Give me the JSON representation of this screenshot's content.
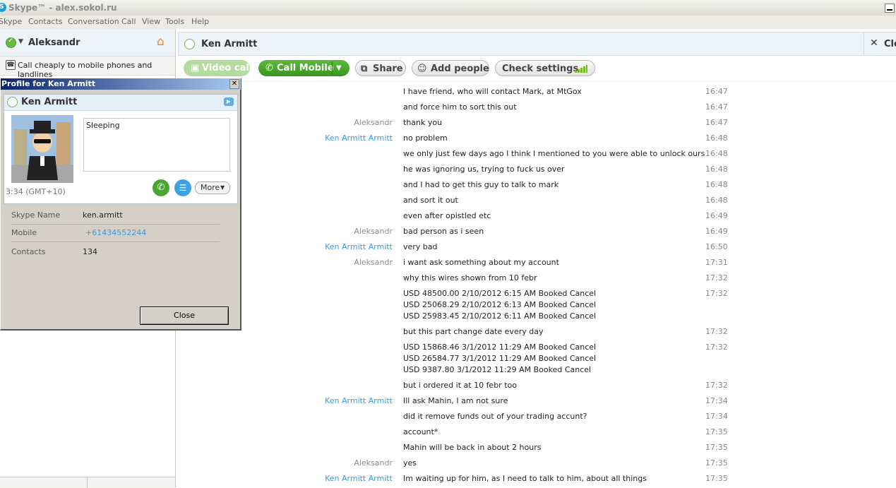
{
  "window": {
    "title": "Skype™ - alex.sokol.ru",
    "icon": "skype-icon"
  },
  "menu": [
    "Skype",
    "Contacts",
    "Conversation",
    "Call",
    "View",
    "Tools",
    "Help"
  ],
  "sidebar": {
    "user_name": "Aleksandr",
    "promo_text": "Call cheaply to mobile phones and landlines",
    "status_color": "#6ab943"
  },
  "conversation": {
    "contact_name": "Ken Armitt",
    "close_label": "Clo",
    "toolbar": {
      "video_call": "Video call",
      "call_mobile": "Call Mobile",
      "share": "Share",
      "add_people": "Add people",
      "check_settings": "Check settings"
    },
    "messages": [
      {
        "sender": "",
        "lines": [
          "I have friend, who will contact Mark, at MtGox"
        ],
        "time": "16:47",
        "ken": false
      },
      {
        "sender": "",
        "lines": [
          "and force him to sort this out"
        ],
        "time": "16:47",
        "ken": false
      },
      {
        "sender": "Aleksandr",
        "lines": [
          "thank you"
        ],
        "time": "16:47",
        "ken": false
      },
      {
        "sender": "Ken Armitt Armitt",
        "lines": [
          "no problem"
        ],
        "time": "16:48",
        "ken": true
      },
      {
        "sender": "",
        "lines": [
          "we only just few days ago I think I mentioned to you were able to unlock ours"
        ],
        "time": "16:48",
        "ken": false
      },
      {
        "sender": "",
        "lines": [
          "he was ignoring us, trying to fuck us over"
        ],
        "time": "16:48",
        "ken": false
      },
      {
        "sender": "",
        "lines": [
          "and I had to get this guy to talk to mark"
        ],
        "time": "16:48",
        "ken": false
      },
      {
        "sender": "",
        "lines": [
          "and sort it out"
        ],
        "time": "16:48",
        "ken": false
      },
      {
        "sender": "",
        "lines": [
          "even after opistled etc"
        ],
        "time": "16:49",
        "ken": false
      },
      {
        "sender": "Aleksandr",
        "lines": [
          "bad person as i seen"
        ],
        "time": "16:49",
        "ken": false
      },
      {
        "sender": "Ken Armitt Armitt",
        "lines": [
          "very bad"
        ],
        "time": "16:50",
        "ken": true
      },
      {
        "sender": "Aleksandr",
        "lines": [
          "i want ask something about my account"
        ],
        "time": "17:31",
        "ken": false
      },
      {
        "sender": "",
        "lines": [
          "why this wires shown from 10 febr"
        ],
        "time": "17:32",
        "ken": false
      },
      {
        "sender": "",
        "lines": [
          "USD  48500.00 2/10/2012 6:15 AM Booked Cancel",
          "USD  25068.29 2/10/2012 6:13 AM Booked Cancel",
          "USD  25983.45 2/10/2012 6:11 AM Booked Cancel"
        ],
        "time": "17:32",
        "ken": false
      },
      {
        "sender": "",
        "lines": [
          "but this part change date every day"
        ],
        "time": "17:32",
        "ken": false
      },
      {
        "sender": "",
        "lines": [
          "USD  15868.46 3/1/2012 11:29 AM Booked Cancel",
          "USD  26584.77 3/1/2012 11:29 AM Booked Cancel",
          "USD  9387.80 3/1/2012 11:29 AM Booked Cancel"
        ],
        "time": "17:32",
        "ken": false
      },
      {
        "sender": "",
        "lines": [
          "but i ordered it at 10 febr too"
        ],
        "time": "17:32",
        "ken": false
      },
      {
        "sender": "Ken Armitt Armitt",
        "lines": [
          "Ill ask Mahin, I am not sure"
        ],
        "time": "17:34",
        "ken": true
      },
      {
        "sender": "",
        "lines": [
          "did it remove funds out of your trading accunt?"
        ],
        "time": "17:34",
        "ken": false
      },
      {
        "sender": "",
        "lines": [
          "account*"
        ],
        "time": "17:35",
        "ken": false
      },
      {
        "sender": "",
        "lines": [
          "Mahin will be back in about 2 hours"
        ],
        "time": "17:35",
        "ken": false
      },
      {
        "sender": "Aleksandr",
        "lines": [
          "yes"
        ],
        "time": "17:35",
        "ken": false
      },
      {
        "sender": "Ken Armitt Armitt",
        "lines": [
          "Im waiting up for him, as I need to talk to him, about all things"
        ],
        "time": "17:35",
        "ken": true
      }
    ]
  },
  "profile": {
    "dialog_title": "Profile for Ken Armitt",
    "name": "Ken Armitt",
    "mood": "Sleeping",
    "local_time": "3:34 (GMT+10)",
    "more_label": "More",
    "fields": [
      {
        "key": "Skype Name",
        "value": "ken.armitt",
        "link": false
      },
      {
        "key": "Mobile",
        "value": "+61434552244",
        "link": true
      },
      {
        "key": "Contacts",
        "value": "134",
        "link": false
      }
    ],
    "close_label": "Close"
  }
}
